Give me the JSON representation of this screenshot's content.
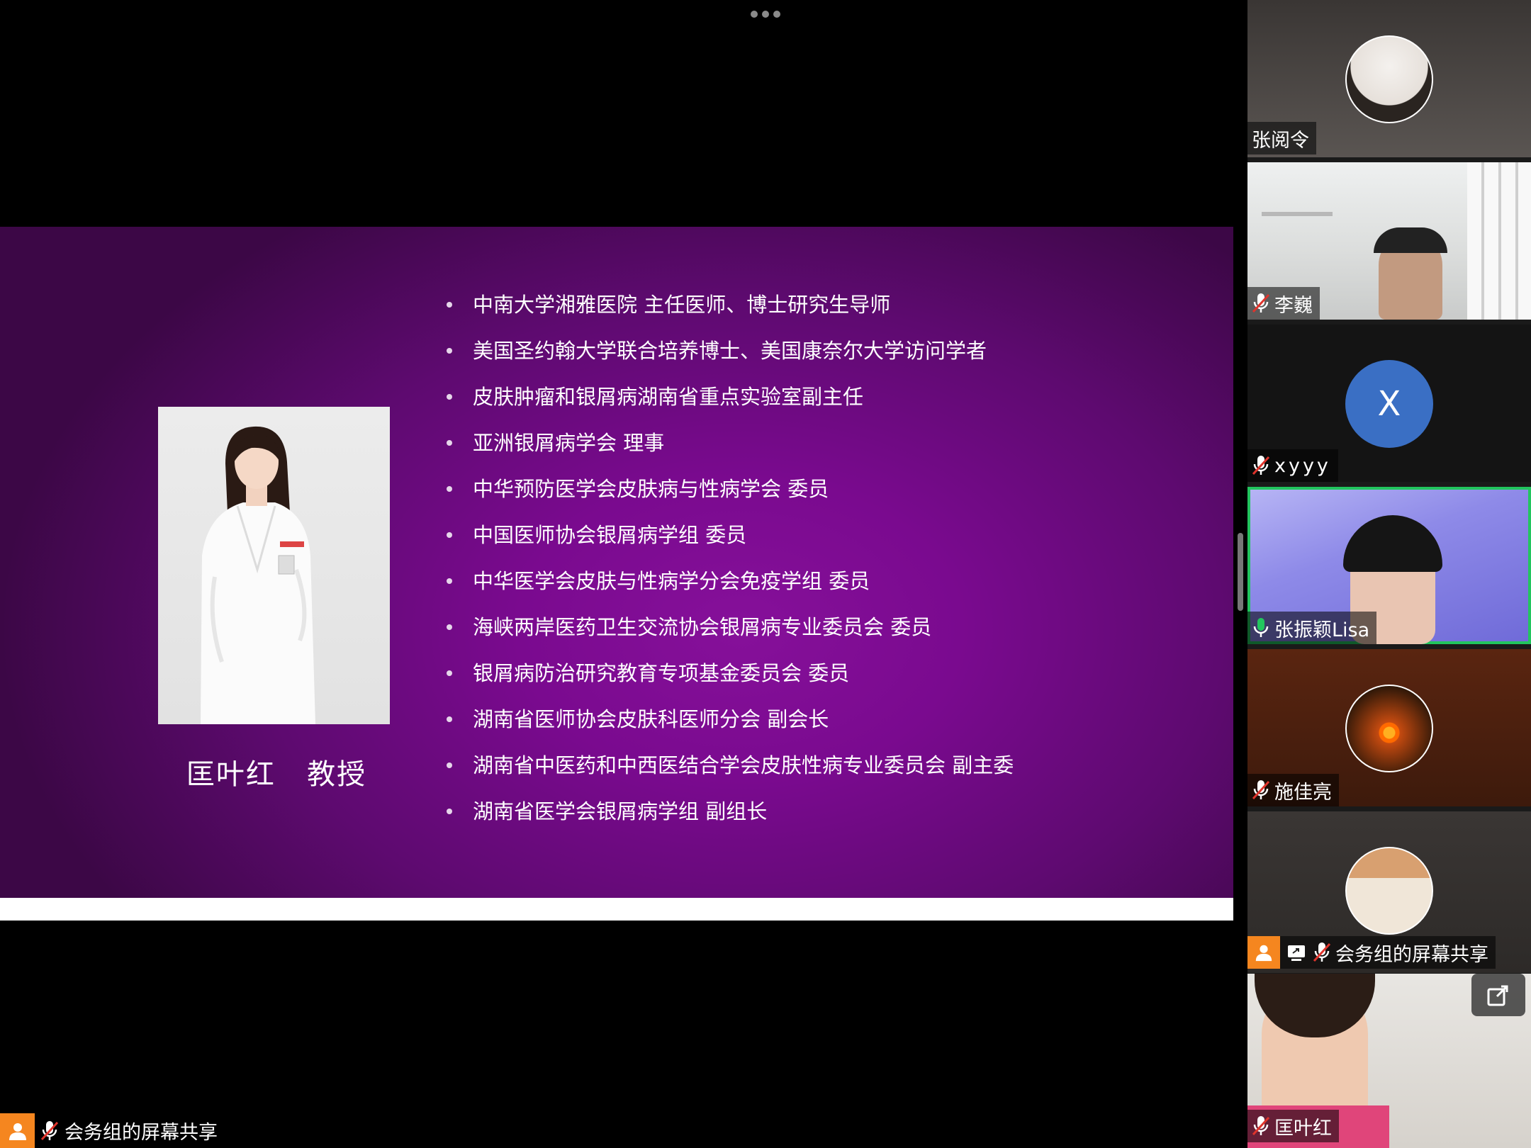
{
  "share": {
    "more_label": "•••",
    "slide": {
      "speaker_name": "匡叶红   教授",
      "bullets": [
        "中南大学湘雅医院 主任医师、博士研究生导师",
        "美国圣约翰大学联合培养博士、美国康奈尔大学访问学者",
        "皮肤肿瘤和银屑病湖南省重点实验室副主任",
        "亚洲银屑病学会 理事",
        "中华预防医学会皮肤病与性病学会 委员",
        "中国医师协会银屑病学组 委员",
        "中华医学会皮肤与性病学分会免疫学组 委员",
        "海峡两岸医药卫生交流协会银屑病专业委员会 委员",
        "银屑病防治研究教育专项基金委员会 委员",
        "湖南省医师协会皮肤科医师分会 副会长",
        "湖南省中医药和中西医结合学会皮肤性病专业委员会 副主委",
        "湖南省医学会银屑病学组 副组长"
      ]
    },
    "sharer_label": "会务组的屏幕共享"
  },
  "gallery": {
    "participants": [
      {
        "name": "张阅令",
        "avatar": "photo"
      },
      {
        "name": "李巍",
        "video": true,
        "muted": true
      },
      {
        "name": "xyyy",
        "avatar_letter": "X",
        "avatar_color": "#3a6fc4",
        "muted": true
      },
      {
        "name": "张振颖Lisa",
        "video": true,
        "speaking": true
      },
      {
        "name": "施佳亮",
        "avatar": "sunset-photo",
        "muted": true
      },
      {
        "name": "会务组的屏幕共享",
        "avatar": "photo",
        "muted": true,
        "sharing": true
      },
      {
        "name": "匡叶红",
        "video": true,
        "muted": true
      }
    ]
  },
  "colors": {
    "slide_purple": "#7a0a8f",
    "active_speaker": "#22c55e",
    "share_badge": "#f5861f"
  }
}
